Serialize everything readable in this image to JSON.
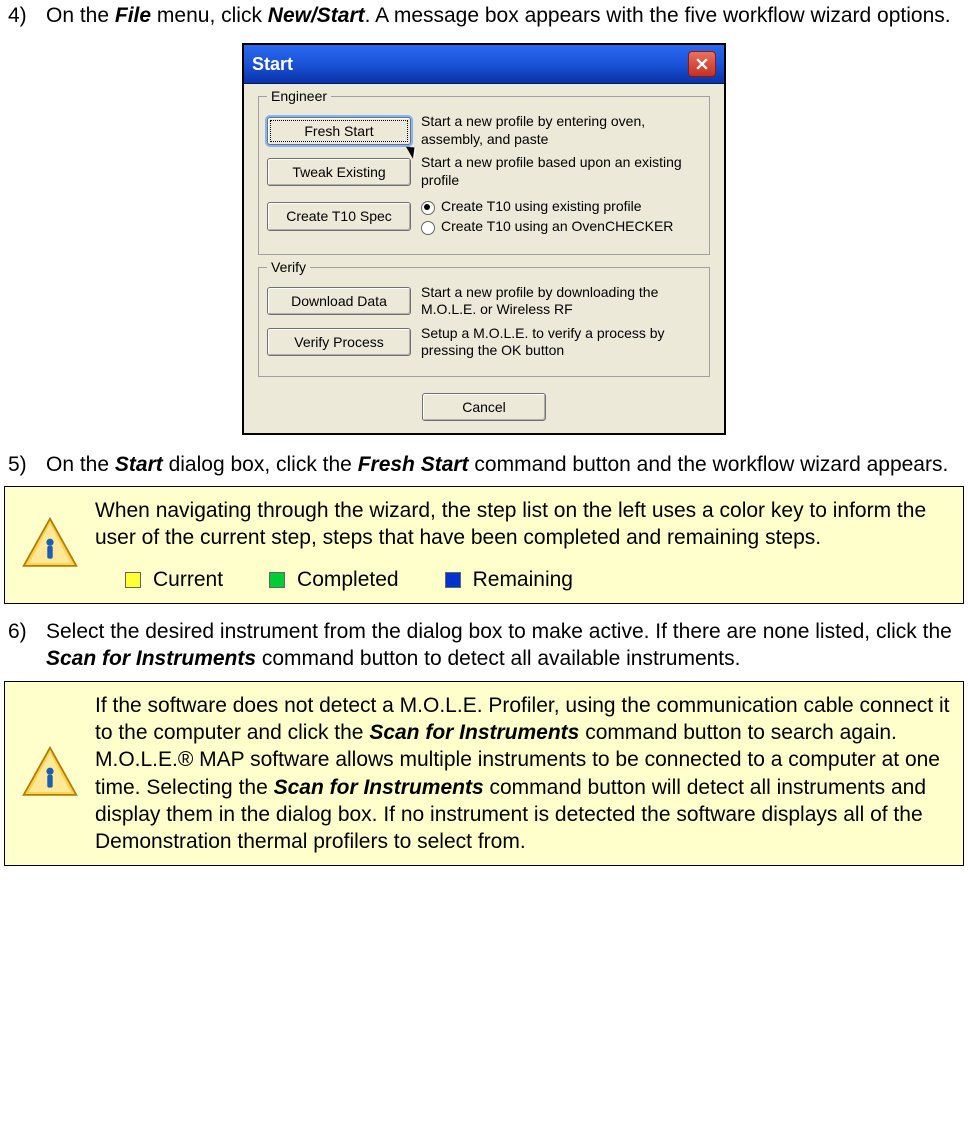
{
  "steps": {
    "s4": {
      "num": "4)",
      "pre": "On the ",
      "file": "File",
      "mid1": " menu, click ",
      "newstart": "New/Start",
      "post": ". A message box appears with the five workflow wizard options."
    },
    "s5": {
      "num": "5)",
      "pre": "On the ",
      "start": "Start",
      "mid1": " dialog box, click the ",
      "fresh": "Fresh Start",
      "post": " command button and the workflow wizard appears."
    },
    "s6": {
      "num": "6)",
      "pre": "Select the desired instrument from the dialog box to make active. If there are none listed, click the ",
      "scan": "Scan for Instruments",
      "post": " command button to detect all available instruments."
    }
  },
  "dialog": {
    "title": "Start",
    "group1": "Engineer",
    "group2": "Verify",
    "btn_fresh": "Fresh Start",
    "desc_fresh": "Start a new profile by entering oven, assembly, and paste",
    "btn_tweak": "Tweak Existing",
    "desc_tweak": "Start a new profile based upon an existing profile",
    "btn_t10": "Create T10 Spec",
    "radio1": "Create T10 using existing profile",
    "radio2": "Create T10 using an OvenCHECKER",
    "btn_download": "Download Data",
    "desc_download": "Start a new profile by downloading the M.O.L.E. or Wireless RF",
    "btn_verify": "Verify Process",
    "desc_verify": "Setup a M.O.L.E. to verify a process by pressing the OK button",
    "btn_cancel": "Cancel"
  },
  "note1": {
    "text": "When navigating through the wizard, the step list on the left uses a color key to inform the user of the current step, steps that have been completed and remaining steps.",
    "legend_current": "Current",
    "legend_completed": "Completed",
    "legend_remaining": "Remaining"
  },
  "note2": {
    "p1a": "If the software does not detect a M.O.L.E. Profiler, using the communication cable connect it to the computer and click the ",
    "scan1": "Scan for Instruments",
    "p1b": " command button to search again. M.O.L.E.® MAP software allows multiple instruments to be connected to a computer at one time. Selecting the ",
    "scan2": "Scan for Instruments",
    "p1c": " command button will detect all instruments and display them in the dialog box. If no instrument is detected the software displays all of the Demonstration thermal profilers to select from."
  }
}
